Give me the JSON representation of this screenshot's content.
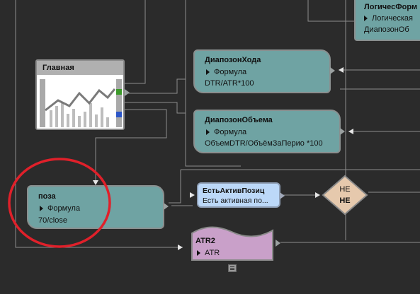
{
  "nodes": {
    "logic": {
      "title": "ЛогичесФорм",
      "type": "Логическая",
      "value": "ДиапозонОб"
    },
    "diapozon_hoda": {
      "title": "ДиапозонХода",
      "type": "Формула",
      "value": "DTR/ATR*100"
    },
    "main": {
      "title": "Главная"
    },
    "diapozon_obema": {
      "title": "ДиапозонОбъема",
      "type": "Формула",
      "value": "ОбъемDTR/ОбъёмЗаПерио *100"
    },
    "poza": {
      "title": "поза",
      "type": "Формула",
      "value": "70/close"
    },
    "est_aktiv": {
      "title": "ЕстьАктивПозиц",
      "value": "Есть активная по..."
    },
    "ne": {
      "top": "НЕ",
      "bottom": "НЕ"
    },
    "atr2": {
      "title": "ATR2",
      "type": "ATR"
    }
  },
  "colors": {
    "background": "#2b2b2b",
    "node_teal": "#6fa3a3",
    "node_blue": "#bcd8f8",
    "node_purple": "#c9a0c9",
    "node_diamond": "#e6c9ad",
    "annotation_circle": "#e0202a"
  }
}
